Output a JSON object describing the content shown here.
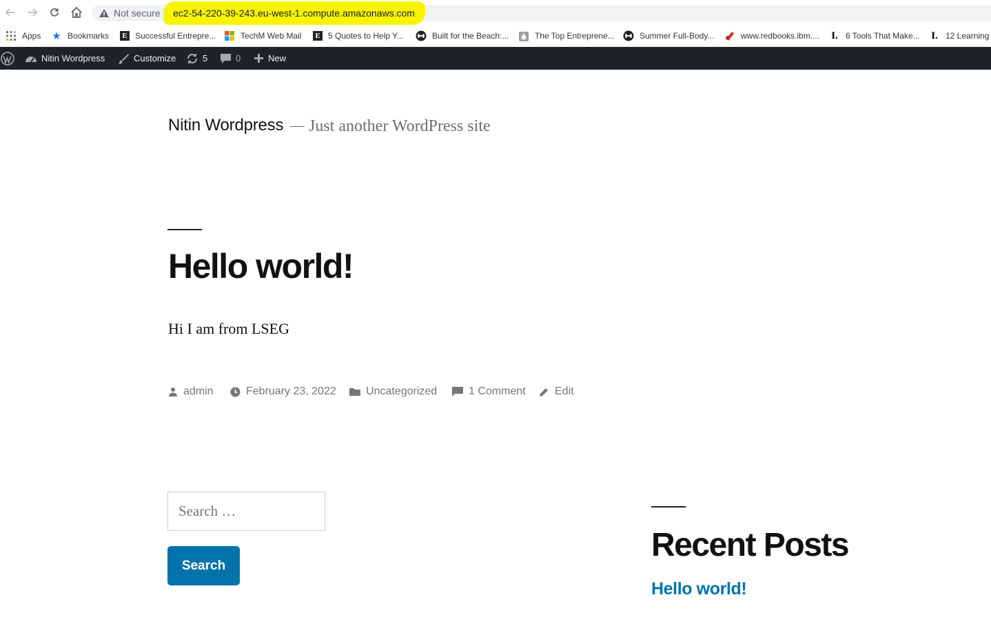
{
  "browser": {
    "security_label": "Not secure",
    "url": "ec2-54-220-39-243.eu-west-1.compute.amazonaws.com",
    "highlight_color": "#f8f400"
  },
  "bookmarks": [
    {
      "icon": "apps-grid-icon",
      "label": "Apps"
    },
    {
      "icon": "star-icon",
      "label": "Bookmarks"
    },
    {
      "icon": "e-logo-icon",
      "label": "Successful Entrepre..."
    },
    {
      "icon": "microsoft-logo-icon",
      "label": "TechM Web Mail"
    },
    {
      "icon": "e-logo-icon",
      "label": "5 Quotes to Help Y..."
    },
    {
      "icon": "dumbbell-icon",
      "label": "Built for the Beach:..."
    },
    {
      "icon": "apple-icon",
      "label": "The Top Entreprene..."
    },
    {
      "icon": "dumbbell-icon",
      "label": "Summer Full-Body..."
    },
    {
      "icon": "redbook-icon",
      "label": "www.redbooks.ibm...."
    },
    {
      "icon": "i-logo-icon",
      "label": "6 Tools That Make..."
    },
    {
      "icon": "i-logo-icon",
      "label": "12 Learning"
    }
  ],
  "adminbar": {
    "site_name": "Nitin Wordpress",
    "customize": "Customize",
    "updates_count": "5",
    "comments_count": "0",
    "new_label": "New",
    "bg_color": "#1d2327"
  },
  "site": {
    "title": "Nitin Wordpress",
    "dash": "—",
    "description": "Just another WordPress site"
  },
  "post": {
    "title": "Hello world!",
    "body": "Hi I am from LSEG",
    "author": "admin",
    "date": "February 23, 2022",
    "category": "Uncategorized",
    "comments": "1 Comment",
    "edit": "Edit"
  },
  "search": {
    "placeholder": "Search …",
    "button": "Search",
    "button_color": "#0073aa"
  },
  "recent_posts": {
    "heading": "Recent Posts",
    "items": [
      "Hello world!"
    ],
    "link_color": "#0073aa"
  }
}
